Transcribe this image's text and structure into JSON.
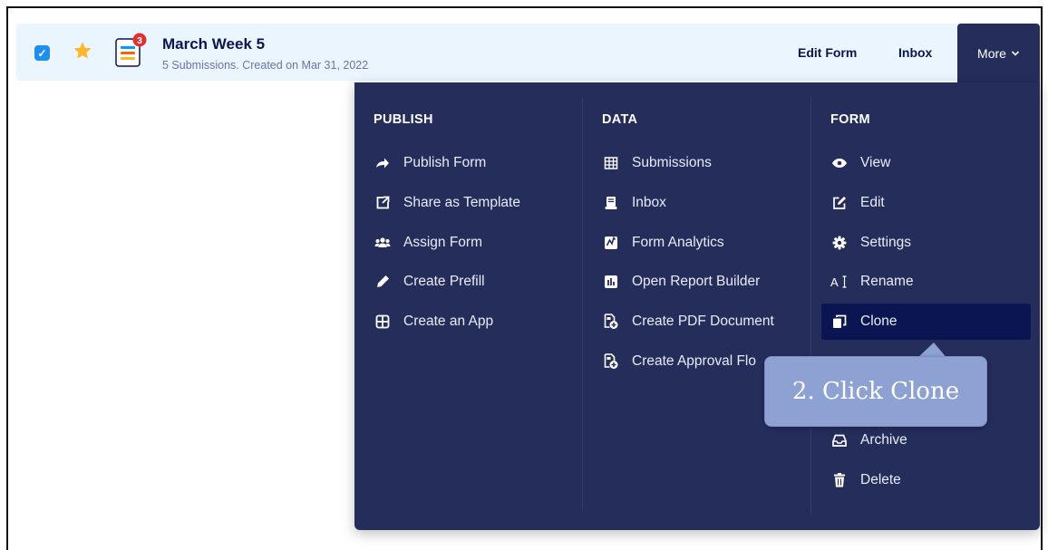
{
  "form_row": {
    "title": "March Week 5",
    "subtitle": "5 Submissions. Created on Mar 31, 2022",
    "badge_count": "3",
    "checkbox_icon": "checkbox-checked-icon",
    "star_icon": "star-icon",
    "form_icon": "form-document-icon"
  },
  "top_actions": {
    "edit_form": "Edit Form",
    "inbox": "Inbox",
    "more": "More"
  },
  "menu": {
    "publish": {
      "heading": "PUBLISH",
      "items": [
        {
          "label": "Publish Form",
          "icon": "arrow-right-icon"
        },
        {
          "label": "Share as Template",
          "icon": "share-template-icon"
        },
        {
          "label": "Assign Form",
          "icon": "users-icon"
        },
        {
          "label": "Create Prefill",
          "icon": "pencil-icon"
        },
        {
          "label": "Create an App",
          "icon": "app-grid-icon"
        }
      ]
    },
    "data": {
      "heading": "DATA",
      "items": [
        {
          "label": "Submissions",
          "icon": "table-icon"
        },
        {
          "label": "Inbox",
          "icon": "inbox-icon"
        },
        {
          "label": "Form Analytics",
          "icon": "analytics-icon"
        },
        {
          "label": "Open Report Builder",
          "icon": "report-icon"
        },
        {
          "label": "Create PDF Document",
          "icon": "pdf-add-icon"
        },
        {
          "label": "Create Approval Flo",
          "icon": "approval-add-icon"
        }
      ]
    },
    "form": {
      "heading": "FORM",
      "items": [
        {
          "label": "View",
          "icon": "eye-icon"
        },
        {
          "label": "Edit",
          "icon": "edit-icon"
        },
        {
          "label": "Settings",
          "icon": "gear-icon"
        },
        {
          "label": "Rename",
          "icon": "rename-icon"
        },
        {
          "label": "Clone",
          "icon": "clone-icon",
          "active": true
        },
        {
          "label": "Archive",
          "icon": "archive-icon"
        },
        {
          "label": "Delete",
          "icon": "trash-icon"
        }
      ]
    }
  },
  "callout": {
    "text": "2. Click Clone"
  },
  "colors": {
    "menu_bg": "#252d5b",
    "active_bg": "#0a1551",
    "row_bg": "#eaf5fd",
    "accent_blue": "#1f8ef1",
    "star": "#ffb629",
    "callout_bg": "#8ea1d3"
  }
}
